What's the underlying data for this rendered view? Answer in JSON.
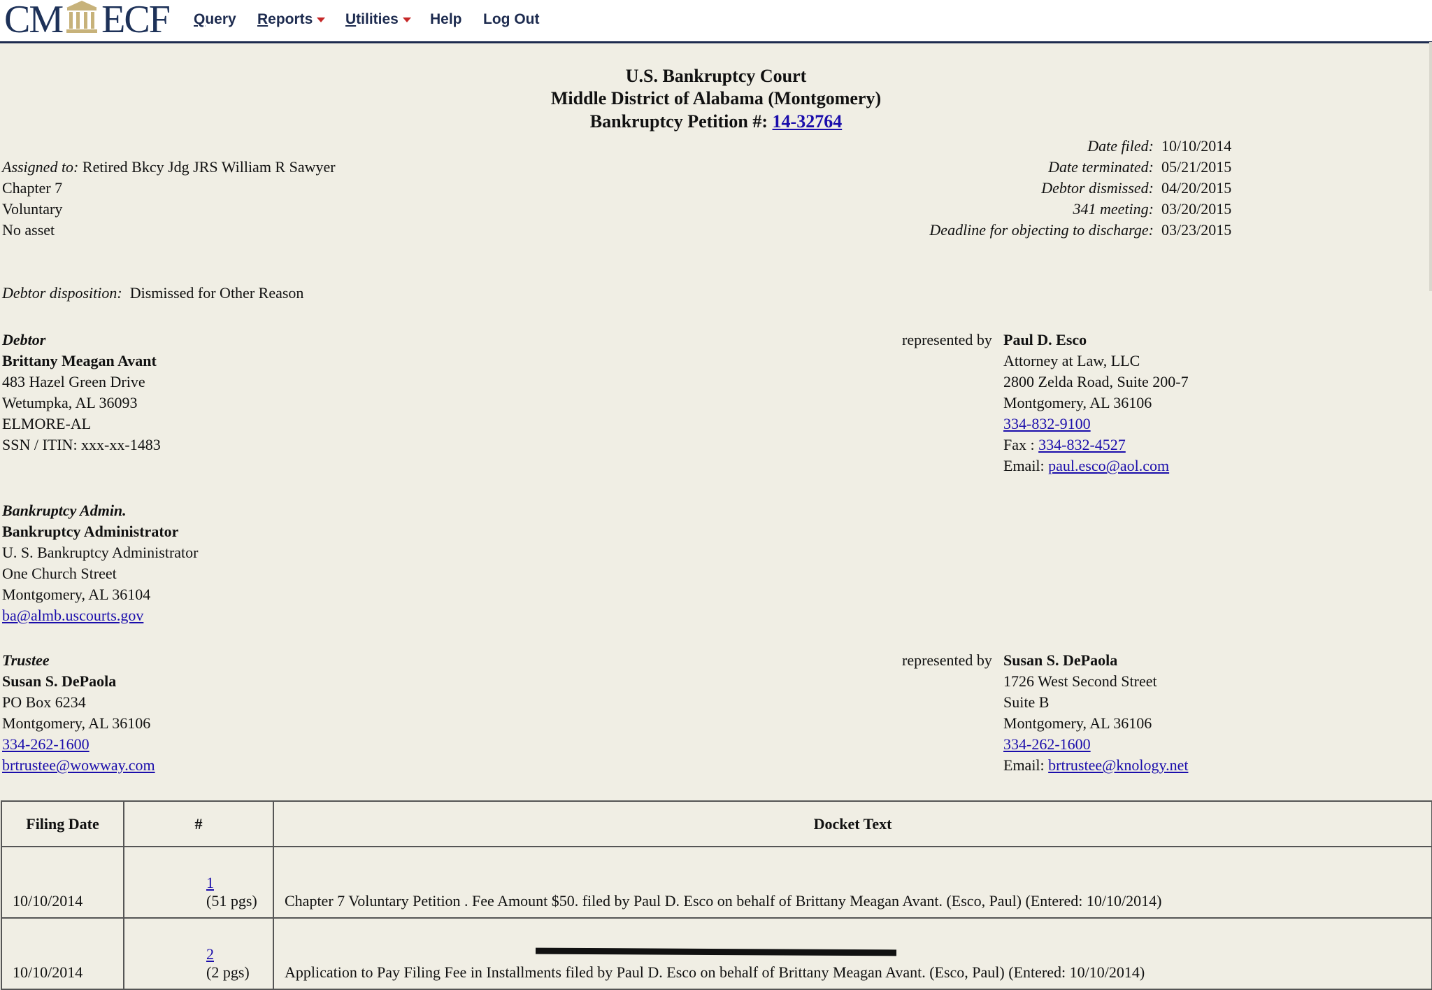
{
  "nav": {
    "logo_left": "CM",
    "logo_right": "ECF",
    "items": [
      {
        "label": "Query",
        "underline": "Q",
        "rest": "uery",
        "caret": false
      },
      {
        "label": "Reports",
        "underline": "R",
        "rest": "eports",
        "caret": true
      },
      {
        "label": "Utilities",
        "underline": "U",
        "rest": "tilities",
        "caret": true
      },
      {
        "label": "Help",
        "caret": false
      },
      {
        "label": "Log Out",
        "caret": false
      }
    ]
  },
  "header": {
    "court": "U.S. Bankruptcy Court",
    "district": "Middle District of Alabama (Montgomery)",
    "petition_label": "Bankruptcy Petition #:",
    "petition_number": "14-32764"
  },
  "case_info": {
    "assigned_label": "Assigned to:",
    "assigned_value": "Retired Bkcy Jdg JRS William R Sawyer",
    "chapter": "Chapter 7",
    "type": "Voluntary",
    "asset": "No asset",
    "dates": [
      {
        "label": "Date filed:",
        "value": "10/10/2014"
      },
      {
        "label": "Date terminated:",
        "value": "05/21/2015"
      },
      {
        "label": "Debtor dismissed:",
        "value": "04/20/2015"
      },
      {
        "label": "341 meeting:",
        "value": "03/20/2015"
      },
      {
        "label": "Deadline for objecting to discharge:",
        "value": "03/23/2015"
      }
    ],
    "disposition_label": "Debtor disposition:",
    "disposition_value": "Dismissed for Other Reason"
  },
  "parties": {
    "debtor": {
      "role": "Debtor",
      "name": "Brittany Meagan Avant",
      "address1": "483 Hazel Green Drive",
      "address2": "Wetumpka, AL 36093",
      "county": "ELMORE-AL",
      "ssn": "SSN / ITIN: xxx-xx-1483",
      "represented_by": "represented by",
      "attorney": {
        "name": "Paul D. Esco",
        "firm": "Attorney at Law, LLC",
        "address1": "2800 Zelda Road, Suite 200-7",
        "address2": "Montgomery, AL 36106",
        "phone": "334-832-9100",
        "fax_label": "Fax :",
        "fax": "334-832-4527",
        "email_label": "Email:",
        "email": "paul.esco@aol.com"
      }
    },
    "admin": {
      "role": "Bankruptcy Admin.",
      "name": "Bankruptcy Administrator",
      "line1": "U. S. Bankruptcy Administrator",
      "line2": "One Church Street",
      "line3": "Montgomery, AL 36104",
      "email": "ba@almb.uscourts.gov"
    },
    "trustee": {
      "role": "Trustee",
      "name": "Susan S. DePaola",
      "line1": "PO Box 6234",
      "line2": "Montgomery, AL 36106",
      "phone": "334-262-1600",
      "email": "brtrustee@wowway.com",
      "represented_by": "represented by",
      "attorney": {
        "name": "Susan S. DePaola",
        "address1": "1726 West Second Street",
        "address2": "Suite B",
        "address3": "Montgomery, AL 36106",
        "phone": "334-262-1600",
        "email_label": "Email:",
        "email": "brtrustee@knology.net"
      }
    }
  },
  "docket": {
    "headers": [
      "Filing Date",
      "#",
      "Docket Text"
    ],
    "rows": [
      {
        "date": "10/10/2014",
        "num": "1",
        "pages": "(51 pgs)",
        "text": "Chapter 7 Voluntary Petition . Fee Amount $50. filed by Paul D. Esco on behalf of Brittany Meagan Avant. (Esco, Paul) (Entered: 10/10/2014)"
      },
      {
        "date": "10/10/2014",
        "num": "2",
        "pages": "(2 pgs)",
        "text": "Application to Pay Filing Fee in Installments filed by Paul D. Esco on behalf of Brittany Meagan Avant. (Esco, Paul) (Entered: 10/10/2014)"
      }
    ]
  }
}
